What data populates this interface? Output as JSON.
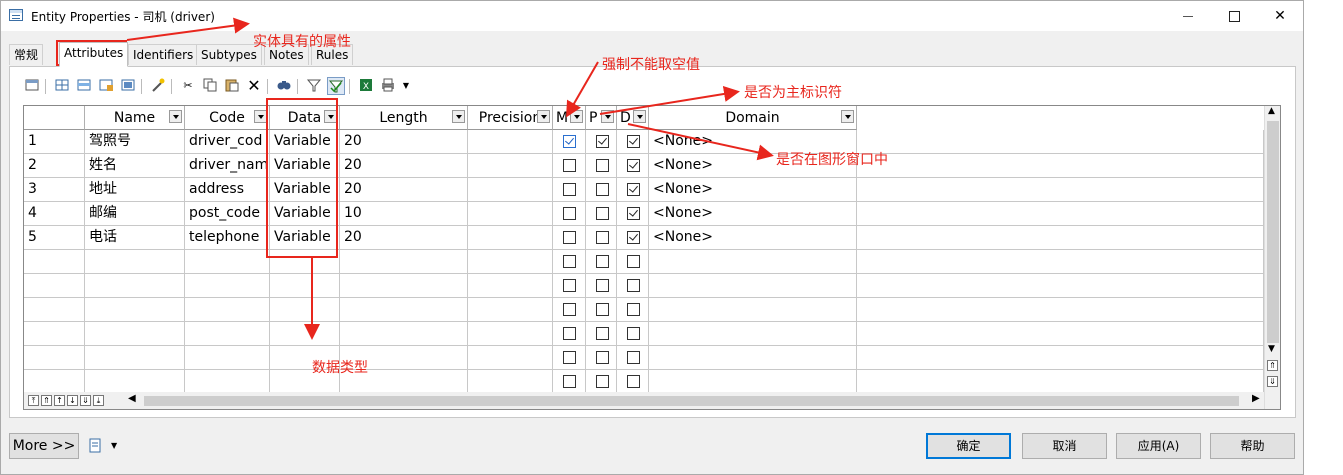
{
  "window": {
    "title": "Entity Properties - 司机 (driver)",
    "minimize": "—",
    "maximize": "□",
    "close": "✕"
  },
  "tabs": [
    {
      "label": "常规"
    },
    {
      "label": "Attributes",
      "active": true
    },
    {
      "label": "Identifiers"
    },
    {
      "label": "Subtypes"
    },
    {
      "label": "Notes"
    },
    {
      "label": "Rules"
    }
  ],
  "grid": {
    "columns": [
      "Name",
      "Code",
      "Data",
      "Length",
      "Precision",
      "M",
      "P",
      "D",
      "Domain"
    ],
    "rows": [
      {
        "num": "1",
        "name": "驾照号",
        "code": "driver_cod",
        "data": "Variable",
        "length": "20",
        "precision": "",
        "m": true,
        "p": true,
        "d": true,
        "domain": "<None>"
      },
      {
        "num": "2",
        "name": "姓名",
        "code": "driver_nam",
        "data": "Variable",
        "length": "20",
        "precision": "",
        "m": false,
        "p": false,
        "d": true,
        "domain": "<None>"
      },
      {
        "num": "3",
        "name": "地址",
        "code": "address",
        "data": "Variable",
        "length": "20",
        "precision": "",
        "m": false,
        "p": false,
        "d": true,
        "domain": "<None>"
      },
      {
        "num": "4",
        "name": "邮编",
        "code": "post_code",
        "data": "Variable",
        "length": "10",
        "precision": "",
        "m": false,
        "p": false,
        "d": true,
        "domain": "<None>"
      },
      {
        "num": "5",
        "name": "电话",
        "code": "telephone",
        "data": "Variable",
        "length": "20",
        "precision": "",
        "m": false,
        "p": false,
        "d": true,
        "domain": "<None>"
      }
    ],
    "empty_rows": 6
  },
  "footer": {
    "more": "More >>",
    "ok": "确定",
    "cancel": "取消",
    "apply": "应用(A)",
    "help": "帮助"
  },
  "annotations": {
    "entity_attrs": "实体具有的属性",
    "mandatory": "强制不能取空值",
    "primary": "是否为主标识符",
    "displayed": "是否在图形窗口中",
    "data_type": "数据类型"
  },
  "colors": {
    "annotation": "#e8261d",
    "default_button_border": "#0078d7"
  }
}
